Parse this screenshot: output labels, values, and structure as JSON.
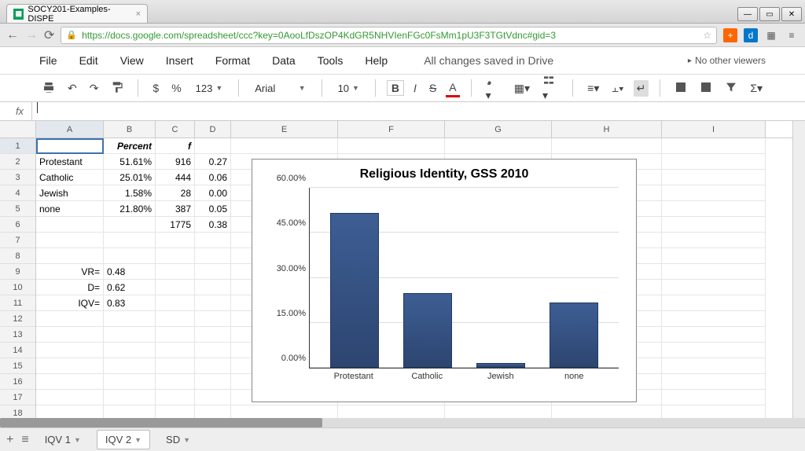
{
  "browser": {
    "tab_title": "SOCY201-Examples-DISPE",
    "url": "https://docs.google.com/spreadsheet/ccc?key=0AooLfDszOP4KdGR5NHVIenFGc0FsMm1pU3F3TGtVdnc#gid=3"
  },
  "menu": {
    "file": "File",
    "edit": "Edit",
    "view": "View",
    "insert": "Insert",
    "format": "Format",
    "data": "Data",
    "tools": "Tools",
    "help": "Help",
    "status": "All changes saved in Drive",
    "viewers": "No other viewers"
  },
  "toolbar": {
    "font": "Arial",
    "size": "10",
    "currency": "$",
    "percent": "%",
    "numfmt": "123"
  },
  "fx": {
    "label": "fx",
    "value": ""
  },
  "columns": [
    "A",
    "B",
    "C",
    "D",
    "E",
    "F",
    "G",
    "H",
    "I"
  ],
  "rows": [
    "1",
    "2",
    "3",
    "4",
    "5",
    "6",
    "7",
    "8",
    "9",
    "10",
    "11",
    "12",
    "13",
    "14",
    "15",
    "16",
    "17",
    "18"
  ],
  "cells": {
    "B1": "Percent",
    "C1": "f",
    "A2": "Protestant",
    "B2": "51.61%",
    "C2": "916",
    "D2": "0.27",
    "A3": "Catholic",
    "B3": "25.01%",
    "C3": "444",
    "D3": "0.06",
    "A4": "Jewish",
    "B4": "1.58%",
    "C4": "28",
    "D4": "0.00",
    "A5": "none",
    "B5": "21.80%",
    "C5": "387",
    "D5": "0.05",
    "C6": "1775",
    "D6": "0.38",
    "A9": "VR=",
    "B9": "0.48",
    "A10": "D=",
    "B10": "0.62",
    "A11": "IQV=",
    "B11": "0.83"
  },
  "chart_data": {
    "type": "bar",
    "title": "Religious Identity, GSS 2010",
    "categories": [
      "Protestant",
      "Catholic",
      "Jewish",
      "none"
    ],
    "values": [
      51.61,
      25.01,
      1.58,
      21.8
    ],
    "ylabel": "",
    "xlabel": "",
    "ylim": [
      0,
      60
    ],
    "yticks": [
      "0.00%",
      "15.00%",
      "30.00%",
      "45.00%",
      "60.00%"
    ]
  },
  "sheet_tabs": {
    "t1": "IQV 1",
    "t2": "IQV 2",
    "t3": "SD"
  }
}
